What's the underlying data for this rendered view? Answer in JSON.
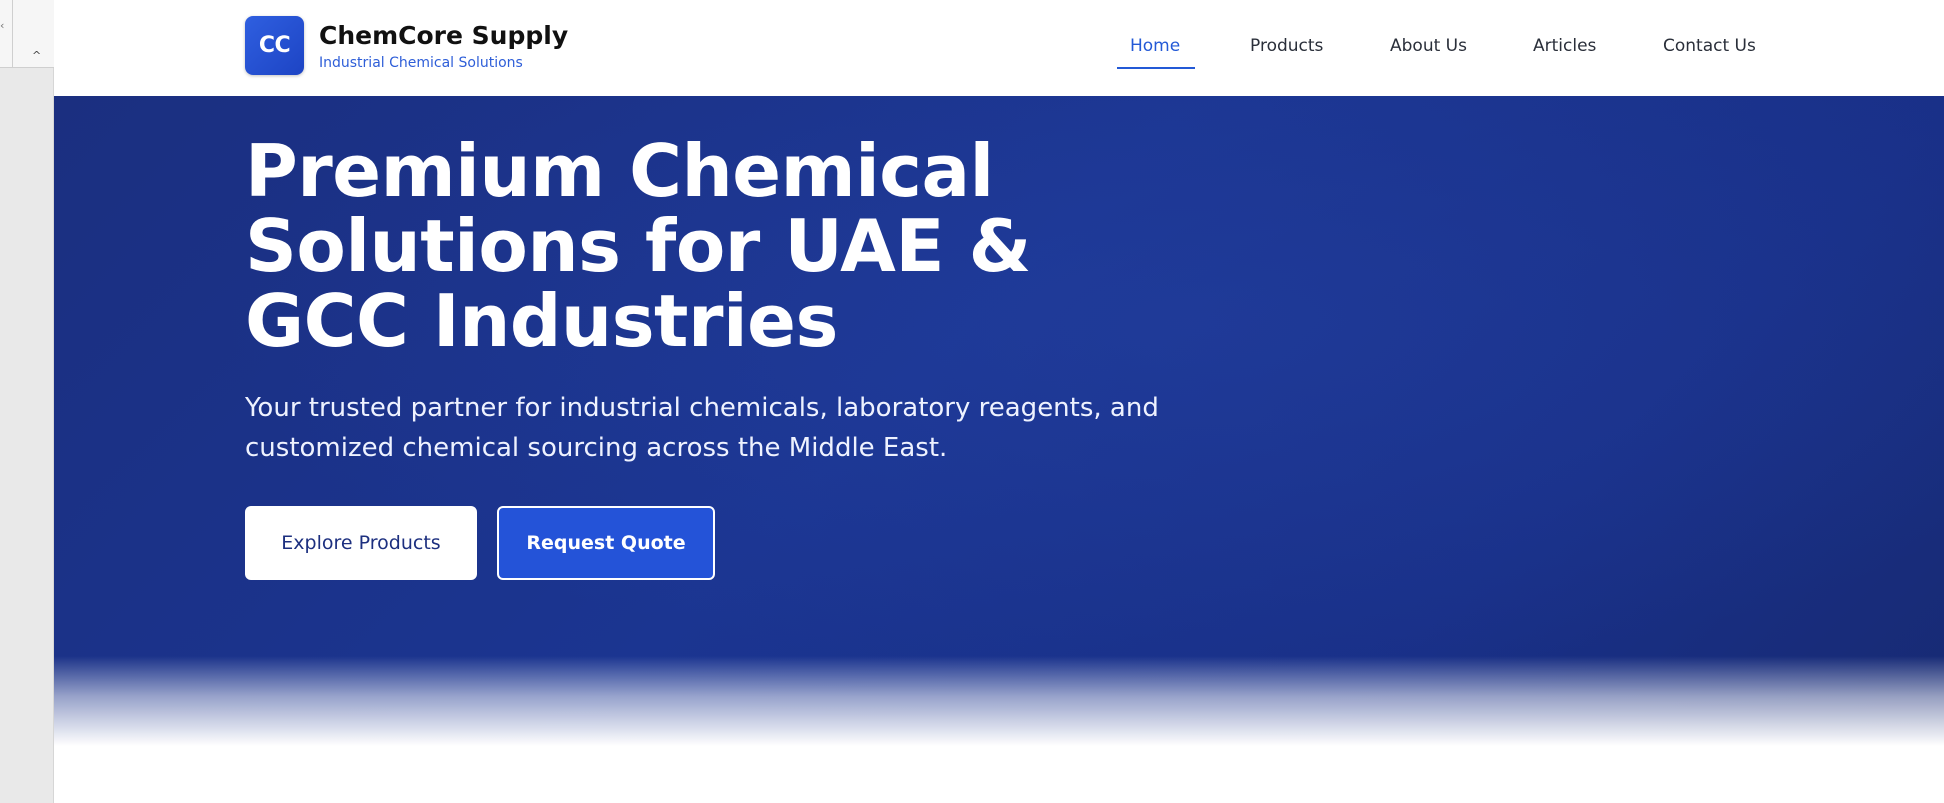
{
  "brand": {
    "logo_text": "CC",
    "name": "ChemCore Supply",
    "tagline": "Industrial Chemical Solutions"
  },
  "nav": {
    "items": [
      {
        "label": "Home",
        "active": true
      },
      {
        "label": "Products",
        "active": false
      },
      {
        "label": "About Us",
        "active": false
      },
      {
        "label": "Articles",
        "active": false
      },
      {
        "label": "Contact Us",
        "active": false
      }
    ]
  },
  "hero": {
    "title": "Premium Chemical Solutions for UAE & GCC Industries",
    "subtitle": "Your trusted partner for industrial chemicals, laboratory reagents, and customized chemical sourcing across the Middle East.",
    "primary_button": "Explore Products",
    "secondary_button": "Request Quote"
  },
  "colors": {
    "accent": "#2359d6",
    "hero_bg": "#1b3591",
    "logo_bg": "#2f5fe0"
  },
  "icons": {
    "gutter_left": "chevron-left-icon",
    "gutter_collapse": "chevron-up-icon"
  }
}
